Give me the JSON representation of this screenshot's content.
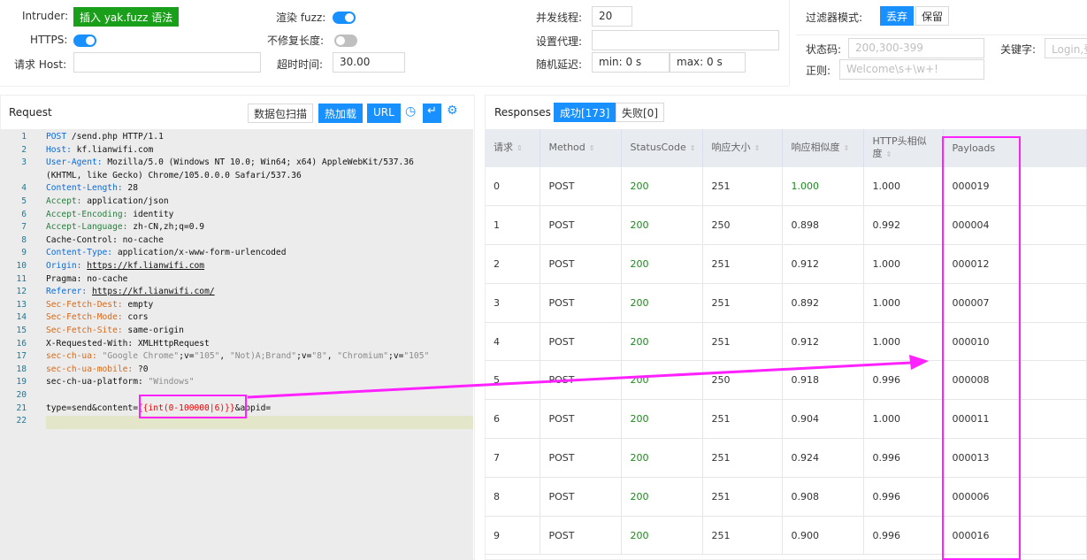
{
  "config": {
    "intruder_label": "Intruder:",
    "insert_button": "插入 yak.fuzz 语法",
    "https_label": "HTTPS:",
    "https_on": true,
    "host_label": "请求 Host:",
    "host_value": "",
    "render_fuzz_label": "渲染 fuzz:",
    "render_fuzz_on": true,
    "no_fix_length_label": "不修复长度:",
    "no_fix_length_on": false,
    "timeout_label": "超时时间:",
    "timeout_value": "30.00",
    "threads_label": "并发线程:",
    "threads_value": "20",
    "proxy_label": "设置代理:",
    "proxy_value": "",
    "delay_label": "随机延迟:",
    "delay_min": "min: 0 s",
    "delay_max": "max: 0 s"
  },
  "filter": {
    "mode_label": "过滤器模式:",
    "mode_discard": "丢弃",
    "mode_keep": "保留",
    "status_label": "状态码:",
    "status_placeholder": "200,300-399",
    "keyword_label": "关键字:",
    "keyword_placeholder": "Login,登",
    "regex_label": "正则:",
    "regex_placeholder": "Welcome\\s+\\w+!"
  },
  "request": {
    "title": "Request",
    "scan_button": "数据包扫描",
    "hot_reload_button": "热加载",
    "url_button": "URL",
    "lines": [
      {
        "n": "1",
        "parts": [
          {
            "t": "POST",
            "c": "kb"
          },
          {
            "t": " /send.php HTTP/1.1",
            "c": ""
          }
        ]
      },
      {
        "n": "2",
        "parts": [
          {
            "t": "Host:",
            "c": "kb"
          },
          {
            "t": " kf.lianwifi.com",
            "c": ""
          }
        ]
      },
      {
        "n": "3",
        "parts": [
          {
            "t": "User-Agent:",
            "c": "kb"
          },
          {
            "t": " Mozilla/5.0 (Windows NT 10.0; Win64; x64) AppleWebKit/537.36",
            "c": ""
          }
        ]
      },
      {
        "n": "",
        "parts": [
          {
            "t": "(KHTML, like Gecko) Chrome/105.0.0.0 Safari/537.36",
            "c": ""
          }
        ]
      },
      {
        "n": "4",
        "parts": [
          {
            "t": "Content-Length:",
            "c": "kb"
          },
          {
            "t": " 28",
            "c": ""
          }
        ]
      },
      {
        "n": "5",
        "parts": [
          {
            "t": "Accept:",
            "c": "kg"
          },
          {
            "t": " application/json",
            "c": ""
          }
        ]
      },
      {
        "n": "6",
        "parts": [
          {
            "t": "Accept-Encoding:",
            "c": "kg"
          },
          {
            "t": " identity",
            "c": ""
          }
        ]
      },
      {
        "n": "7",
        "parts": [
          {
            "t": "Accept-Language:",
            "c": "kg"
          },
          {
            "t": " zh-CN,zh;q=0.9",
            "c": ""
          }
        ]
      },
      {
        "n": "8",
        "parts": [
          {
            "t": "Cache-Control: no-cache",
            "c": ""
          }
        ]
      },
      {
        "n": "9",
        "parts": [
          {
            "t": "Content-Type:",
            "c": "kb"
          },
          {
            "t": " application/x-www-form-urlencoded",
            "c": ""
          }
        ]
      },
      {
        "n": "10",
        "parts": [
          {
            "t": "Origin:",
            "c": "kb"
          },
          {
            "t": " ",
            "c": ""
          },
          {
            "t": "https://kf.lianwifi.com",
            "c": "u"
          }
        ]
      },
      {
        "n": "11",
        "parts": [
          {
            "t": "Pragma: no-cache",
            "c": ""
          }
        ]
      },
      {
        "n": "12",
        "parts": [
          {
            "t": "Referer:",
            "c": "kb"
          },
          {
            "t": " ",
            "c": ""
          },
          {
            "t": "https://kf.lianwifi.com/",
            "c": "u"
          }
        ]
      },
      {
        "n": "13",
        "parts": [
          {
            "t": "Sec-Fetch-Dest:",
            "c": "ko"
          },
          {
            "t": " empty",
            "c": ""
          }
        ]
      },
      {
        "n": "14",
        "parts": [
          {
            "t": "Sec-Fetch-Mode:",
            "c": "ko"
          },
          {
            "t": " cors",
            "c": ""
          }
        ]
      },
      {
        "n": "15",
        "parts": [
          {
            "t": "Sec-Fetch-Site:",
            "c": "ko"
          },
          {
            "t": " same-origin",
            "c": ""
          }
        ]
      },
      {
        "n": "16",
        "parts": [
          {
            "t": "X-Requested-With: XMLHttpRequest",
            "c": ""
          }
        ]
      },
      {
        "n": "17",
        "parts": [
          {
            "t": "sec-ch-ua:",
            "c": "ko"
          },
          {
            "t": " ",
            "c": ""
          },
          {
            "t": "\"Google Chrome\"",
            "c": "str"
          },
          {
            "t": ";v=",
            "c": ""
          },
          {
            "t": "\"105\"",
            "c": "str"
          },
          {
            "t": ", ",
            "c": ""
          },
          {
            "t": "\"Not)A;Brand\"",
            "c": "str"
          },
          {
            "t": ";v=",
            "c": ""
          },
          {
            "t": "\"8\"",
            "c": "str"
          },
          {
            "t": ", ",
            "c": ""
          },
          {
            "t": "\"Chromium\"",
            "c": "str"
          },
          {
            "t": ";v=",
            "c": ""
          },
          {
            "t": "\"105\"",
            "c": "str"
          }
        ]
      },
      {
        "n": "18",
        "parts": [
          {
            "t": "sec-ch-ua-mobile:",
            "c": "ko"
          },
          {
            "t": " ?0",
            "c": ""
          }
        ]
      },
      {
        "n": "19",
        "parts": [
          {
            "t": "sec-ch-ua-platform: ",
            "c": ""
          },
          {
            "t": "\"Windows\"",
            "c": "str"
          }
        ]
      },
      {
        "n": "20",
        "parts": []
      },
      {
        "n": "21",
        "parts": [
          {
            "t": "type=send&content=",
            "c": ""
          },
          {
            "t": "{{int(0-100000|6)}}",
            "c": "red"
          },
          {
            "t": "&appid=",
            "c": ""
          }
        ]
      },
      {
        "n": "22",
        "parts": []
      }
    ]
  },
  "responses": {
    "title": "Responses",
    "success_tab": "成功[173]",
    "fail_tab": "失败[0]",
    "columns": [
      "请求",
      "Method",
      "StatusCode",
      "响应大小",
      "响应相似度",
      "HTTP头相似度",
      "Payloads"
    ],
    "rows": [
      [
        "0",
        "POST",
        "200",
        "251",
        "1.000",
        "1.000",
        "000019"
      ],
      [
        "1",
        "POST",
        "200",
        "250",
        "0.898",
        "0.992",
        "000004"
      ],
      [
        "2",
        "POST",
        "200",
        "251",
        "0.912",
        "1.000",
        "000012"
      ],
      [
        "3",
        "POST",
        "200",
        "251",
        "0.892",
        "1.000",
        "000007"
      ],
      [
        "4",
        "POST",
        "200",
        "251",
        "0.912",
        "1.000",
        "000010"
      ],
      [
        "5",
        "POST",
        "200",
        "250",
        "0.918",
        "0.996",
        "000008"
      ],
      [
        "6",
        "POST",
        "200",
        "251",
        "0.904",
        "1.000",
        "000011"
      ],
      [
        "7",
        "POST",
        "200",
        "251",
        "0.924",
        "0.996",
        "000013"
      ],
      [
        "8",
        "POST",
        "200",
        "251",
        "0.908",
        "0.996",
        "000006"
      ],
      [
        "9",
        "POST",
        "200",
        "251",
        "0.900",
        "0.996",
        "000016"
      ]
    ]
  },
  "colors": {
    "accent": "#1890ff",
    "insert_green": "#1a9f1a",
    "highlight": "#ff22ff"
  }
}
